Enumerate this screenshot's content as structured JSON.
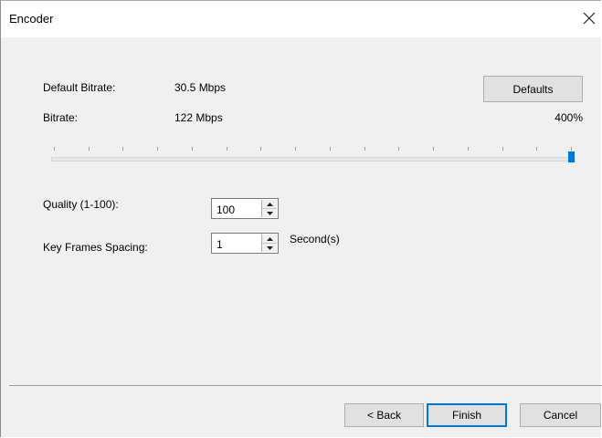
{
  "window": {
    "title": "Encoder"
  },
  "bitrate": {
    "default_label": "Default Bitrate:",
    "default_value": "30.5 Mbps",
    "label": "Bitrate:",
    "value": "122 Mbps",
    "percent": "400%",
    "defaults_button": "Defaults",
    "slider_level": 1.0
  },
  "quality": {
    "label": "Quality (1-100):",
    "value": "100"
  },
  "keyframes": {
    "label": "Key Frames Spacing:",
    "value": "1",
    "unit": "Second(s)"
  },
  "footer": {
    "back": "< Back",
    "finish": "Finish",
    "cancel": "Cancel"
  },
  "colors": {
    "accent": "#0078d7",
    "dialog_bg": "#f0f0f0"
  }
}
